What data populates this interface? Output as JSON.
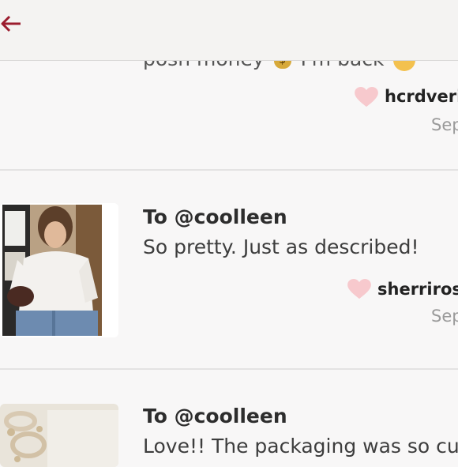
{
  "header": {
    "back_icon": "back-arrow-icon",
    "accent": "#9b1c2e"
  },
  "reviews": [
    {
      "message_tail": "posh money",
      "tail_end": "I'm back",
      "user": "hcrdveri",
      "date": "Sep"
    },
    {
      "to": "To @coolleen",
      "message": "So pretty. Just as described!",
      "user": "sherrirose",
      "date": "Sep"
    },
    {
      "to": "To @coolleen",
      "message": "Love!! The packaging was so cu"
    }
  ],
  "colors": {
    "heart": "#f7c9cd",
    "divider": "#e4e3e3",
    "muted": "#9a9a9a"
  }
}
